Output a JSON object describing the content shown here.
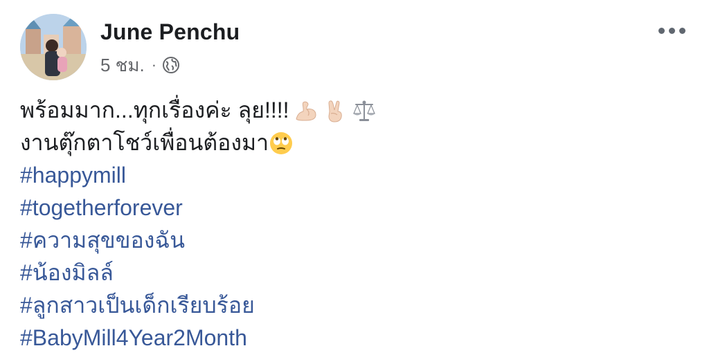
{
  "post": {
    "author": "June Penchu",
    "time": "5 ชม.",
    "separator": "·",
    "privacy_icon": "globe-icon",
    "more_icon": "more-horizontal-icon",
    "lines": [
      {
        "text": "พร้อมมาก...ทุกเรื่องค่ะ ลุย!!!!",
        "emojis": [
          "flexed-biceps-icon",
          "victory-hand-icon",
          "balance-scale-icon"
        ]
      },
      {
        "text": "งานตุ๊กตาโชว์เพื่อนต้องมา",
        "emojis": [
          "eye-roll-face-icon"
        ]
      }
    ],
    "hashtags": [
      "#happymill",
      "#togetherforever",
      "#ความสุขของฉัน",
      "#น้องมิลล์",
      "#ลูกสาวเป็นเด็กเรียบร้อย",
      "#BabyMill4Year2Month"
    ]
  },
  "colors": {
    "text": "#1c1e21",
    "meta": "#65676b",
    "hashtag": "#385898",
    "dots": "#606770"
  }
}
